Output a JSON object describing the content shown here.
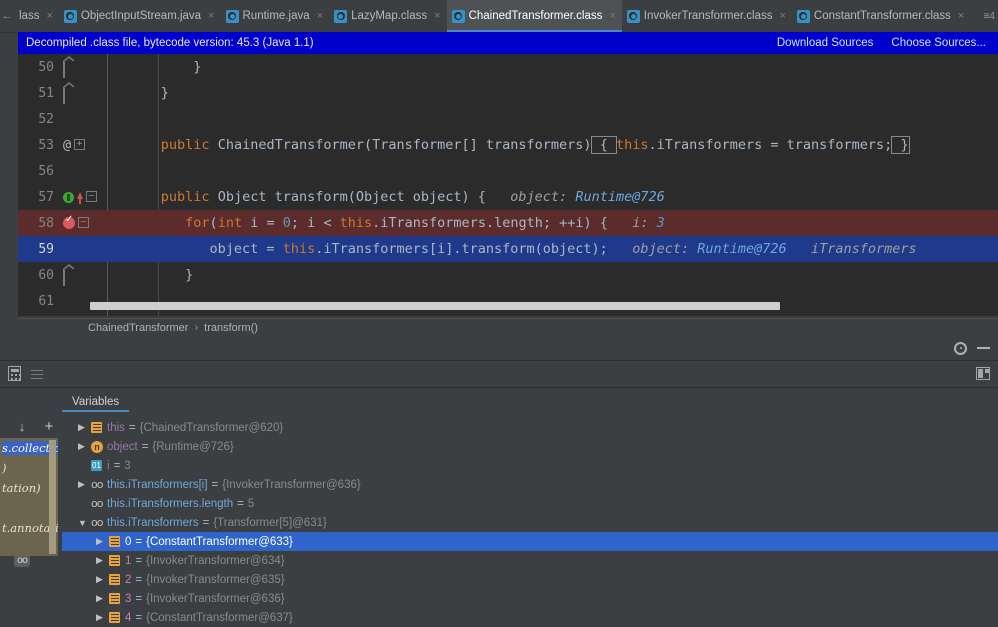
{
  "tabbar": {
    "scroll_left_icon": "arrow-left-icon",
    "tabs": [
      {
        "label": "lass",
        "active": false,
        "partial": true
      },
      {
        "label": "ObjectInputStream.java",
        "active": false
      },
      {
        "label": "Runtime.java",
        "active": false
      },
      {
        "label": "LazyMap.class",
        "active": false
      },
      {
        "label": "ChainedTransformer.class",
        "active": true
      },
      {
        "label": "InvokerTransformer.class",
        "active": false
      },
      {
        "label": "ConstantTransformer.class",
        "active": false
      }
    ],
    "overflow_label": "≡4"
  },
  "banner": {
    "message": "Decompiled .class file, bytecode version: 45.3 (Java 1.1)",
    "download_sources": "Download Sources",
    "choose_sources": "Choose Sources..."
  },
  "editor": {
    "lines": [
      {
        "num": "50",
        "fold": "home",
        "tokens": [
          {
            "t": "          }",
            "c": "txt"
          }
        ]
      },
      {
        "num": "51",
        "fold": "home",
        "tokens": [
          {
            "t": "      }",
            "c": "txt"
          }
        ]
      },
      {
        "num": "52",
        "fold": "none",
        "tokens": [
          {
            "t": "",
            "c": "txt"
          }
        ]
      },
      {
        "num": "53",
        "at": "@",
        "fold": "plus",
        "tokens": [
          {
            "t": "      ",
            "c": "txt"
          },
          {
            "t": "public ",
            "c": "kw"
          },
          {
            "t": "ChainedTransformer(Transformer[] transformers)",
            "c": "txt"
          },
          {
            "t": " { ",
            "c": "box"
          },
          {
            "t": "this",
            "c": "kw"
          },
          {
            "t": ".iTransformers = transformers;",
            "c": "txt"
          },
          {
            "t": " }",
            "c": "box2"
          }
        ]
      },
      {
        "num": "56",
        "fold": "none",
        "tokens": [
          {
            "t": "",
            "c": "txt"
          }
        ]
      },
      {
        "num": "57",
        "fold": "minus",
        "marker": "run-to-cursor",
        "tokens": [
          {
            "t": "      ",
            "c": "txt"
          },
          {
            "t": "public ",
            "c": "kw"
          },
          {
            "t": "Object transform(Object object) {",
            "c": "txt"
          },
          {
            "t": "   object:",
            "c": "hint"
          },
          {
            "t": " Runtime@726",
            "c": "hintv"
          }
        ]
      },
      {
        "num": "58",
        "fold": "minus",
        "marker": "breakpoint-verified",
        "highlight": "red",
        "tokens": [
          {
            "t": "         ",
            "c": "txt"
          },
          {
            "t": "for",
            "c": "kw"
          },
          {
            "t": "(",
            "c": "txt"
          },
          {
            "t": "int ",
            "c": "kw"
          },
          {
            "t": "i = ",
            "c": "txt"
          },
          {
            "t": "0",
            "c": "num"
          },
          {
            "t": "; i < ",
            "c": "txt"
          },
          {
            "t": "this",
            "c": "kw"
          },
          {
            "t": ".iTransformers.length; ++i) {",
            "c": "txt"
          },
          {
            "t": "   i:",
            "c": "hint"
          },
          {
            "t": " 3",
            "c": "hintnum"
          }
        ]
      },
      {
        "num": "59",
        "fold": "none",
        "highlight": "blue",
        "tokens": [
          {
            "t": "            object = ",
            "c": "txt"
          },
          {
            "t": "this",
            "c": "kw"
          },
          {
            "t": ".iTransformers[i].transform(object);",
            "c": "txt"
          },
          {
            "t": "   object:",
            "c": "hint"
          },
          {
            "t": " Runtime@726",
            "c": "hintv"
          },
          {
            "t": "   iTransformers",
            "c": "hint"
          }
        ]
      },
      {
        "num": "60",
        "fold": "home",
        "tokens": [
          {
            "t": "         }",
            "c": "txt"
          }
        ]
      },
      {
        "num": "61",
        "fold": "none",
        "tokens": [
          {
            "t": "",
            "c": "txt"
          }
        ]
      }
    ]
  },
  "breadcrumb": {
    "class": "ChainedTransformer",
    "separator": "›",
    "method": "transform()"
  },
  "debug_panel": {
    "title_icons": {
      "settings": "gear-icon",
      "minimize": "minimize-icon"
    },
    "toolbar_icons": {
      "evaluate": "calculator-icon",
      "group": "lines-icon",
      "layout": "layout-settings-icon"
    },
    "tabs": [
      {
        "label": "Variables",
        "active": true
      }
    ],
    "rail_icons": [
      "arrow-down-icon",
      "filter-icon",
      "add-watch-icon",
      "remove-watch-icon",
      "move-up-icon",
      "move-down-icon",
      "copy-icon",
      "inspect-icon"
    ],
    "variables": [
      {
        "indent": 0,
        "tri": "collapsed",
        "icon": "object-icon",
        "name": "this",
        "eq": "=",
        "value": "{ChainedTransformer@620}",
        "selected": false
      },
      {
        "indent": 0,
        "tri": "collapsed",
        "icon": "n-badge-icon",
        "name": "object",
        "eq": "=",
        "value": "{Runtime@726}",
        "selected": false
      },
      {
        "indent": 0,
        "tri": "none",
        "icon": "primitive-icon",
        "name": "i",
        "eq": "=",
        "value": "3",
        "selected": false
      },
      {
        "indent": 0,
        "tri": "collapsed",
        "icon": "oo-icon",
        "name": "this.iTransformers[i]",
        "eq": "=",
        "value": "{InvokerTransformer@636}",
        "name_style": "blue",
        "selected": false
      },
      {
        "indent": 0,
        "tri": "none",
        "icon": "oo-icon",
        "name": "this.iTransformers.length",
        "eq": "=",
        "value": "5",
        "name_style": "blue",
        "selected": false
      },
      {
        "indent": 0,
        "tri": "expanded",
        "icon": "oo-icon",
        "name": "this.iTransformers",
        "eq": "=",
        "value": "{Transformer[5]@631}",
        "name_style": "blue",
        "selected": false
      },
      {
        "indent": 1,
        "tri": "collapsed",
        "icon": "object-icon",
        "name": "0",
        "eq": "=",
        "value": "{ConstantTransformer@633}",
        "name_style": "idx",
        "selected": true
      },
      {
        "indent": 1,
        "tri": "collapsed",
        "icon": "object-icon",
        "name": "1",
        "eq": "=",
        "value": "{InvokerTransformer@634}",
        "name_style": "idx",
        "selected": false
      },
      {
        "indent": 1,
        "tri": "collapsed",
        "icon": "object-icon",
        "name": "2",
        "eq": "=",
        "value": "{InvokerTransformer@635}",
        "name_style": "idx",
        "selected": false
      },
      {
        "indent": 1,
        "tri": "collapsed",
        "icon": "object-icon",
        "name": "3",
        "eq": "=",
        "value": "{InvokerTransformer@636}",
        "name_style": "idx",
        "selected": false
      },
      {
        "indent": 1,
        "tri": "collapsed",
        "icon": "object-icon",
        "name": "4",
        "eq": "=",
        "value": "{ConstantTransformer@637}",
        "name_style": "idx",
        "selected": false
      }
    ]
  },
  "popup_fragment": {
    "lines": [
      "s.collectio",
      ")",
      "tation)",
      "",
      "t.annotati"
    ]
  }
}
